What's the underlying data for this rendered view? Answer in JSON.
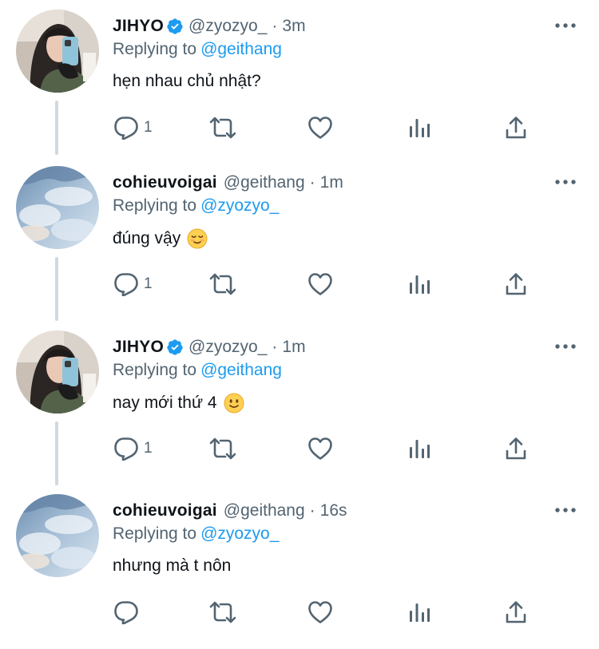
{
  "colors": {
    "accent": "#1d9bf0",
    "muted": "#536471",
    "text": "#0f1419",
    "thread_line": "#cfd9de"
  },
  "tweets": [
    {
      "display_name": "JIHYO",
      "verified": true,
      "handle": "@zyozyo_",
      "separator": "·",
      "time": "3m",
      "replying_label": "Replying to",
      "replying_to": "@geithang",
      "text": "hẹn nhau chủ nhật?",
      "emoji": "",
      "reply_count": "1",
      "avatar": "jihyo-selfie"
    },
    {
      "display_name": "cohieuvoigai",
      "verified": false,
      "handle": "@geithang",
      "separator": "·",
      "time": "1m",
      "replying_label": "Replying to",
      "replying_to": "@zyozyo_",
      "text": "đúng vậy",
      "emoji": "relieved-face",
      "reply_count": "1",
      "avatar": "sky-clouds"
    },
    {
      "display_name": "JIHYO",
      "verified": true,
      "handle": "@zyozyo_",
      "separator": "·",
      "time": "1m",
      "replying_label": "Replying to",
      "replying_to": "@geithang",
      "text": "nay mới thứ 4",
      "emoji": "slightly-smiling-face",
      "reply_count": "1",
      "avatar": "jihyo-selfie"
    },
    {
      "display_name": "cohieuvoigai",
      "verified": false,
      "handle": "@geithang",
      "separator": "·",
      "time": "16s",
      "replying_label": "Replying to",
      "replying_to": "@zyozyo_",
      "text": "nhưng mà t nôn",
      "emoji": "",
      "reply_count": "",
      "avatar": "sky-clouds"
    }
  ],
  "icons": {
    "more": "more-horizontal-icon",
    "reply": "reply-bubble-icon",
    "retweet": "retweet-icon",
    "like": "heart-icon",
    "views": "views-bar-icon",
    "share": "share-upload-icon",
    "verified": "verified-badge-icon"
  }
}
